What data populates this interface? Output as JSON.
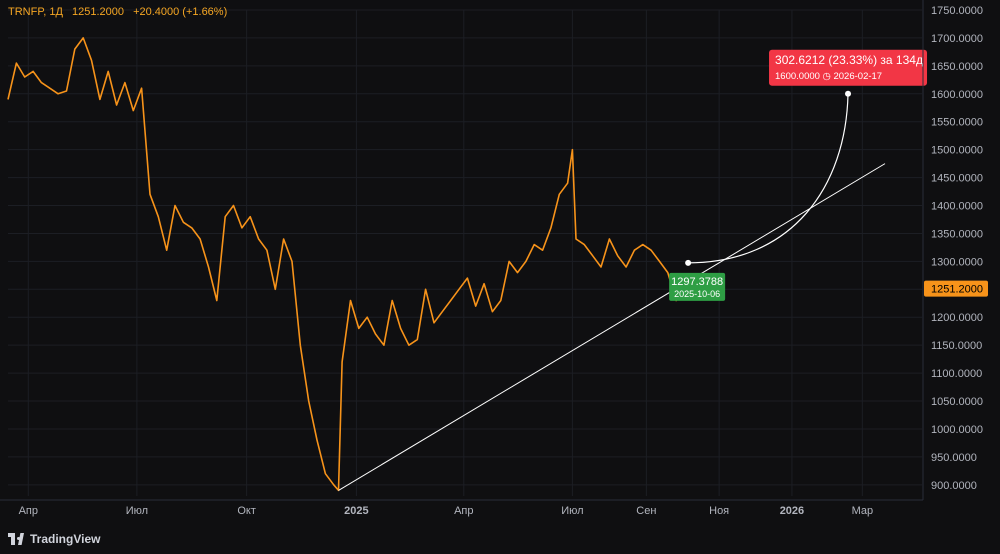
{
  "legend": {
    "ticker": "TRNFP, 1Д",
    "price": "1251.2000",
    "change": "+20.4000 (+1.66%)"
  },
  "branding": {
    "name": "TradingView",
    "icon": "tradingview-logo-icon"
  },
  "colors": {
    "price_line": "#f7931a",
    "background": "#0f0f11",
    "up_box": "#2e9e44",
    "down_box": "#f23645",
    "trend_line": "#ffffff",
    "axis_text": "#b2b5be"
  },
  "chart_data": {
    "type": "line",
    "title": "",
    "xlabel": "",
    "ylabel": "",
    "ylim": [
      880,
      1750
    ],
    "y_ticks": [
      "1750.0000",
      "1700.0000",
      "1650.0000",
      "1600.0000",
      "1550.0000",
      "1500.0000",
      "1450.0000",
      "1400.0000",
      "1350.0000",
      "1300.0000",
      "1250.0000",
      "1200.0000",
      "1150.0000",
      "1100.0000",
      "1050.0000",
      "1000.0000",
      "950.0000",
      "900.0000"
    ],
    "x_range": [
      "2024-03-15",
      "2026-04-20"
    ],
    "x_ticks": [
      {
        "label": "Апр",
        "date": "2024-04-01"
      },
      {
        "label": "Июл",
        "date": "2024-07-01"
      },
      {
        "label": "Окт",
        "date": "2024-10-01"
      },
      {
        "label": "2025",
        "date": "2025-01-01"
      },
      {
        "label": "Апр",
        "date": "2025-04-01"
      },
      {
        "label": "Июл",
        "date": "2025-07-01"
      },
      {
        "label": "Сен",
        "date": "2025-09-01"
      },
      {
        "label": "Ноя",
        "date": "2025-11-01"
      },
      {
        "label": "2026",
        "date": "2026-01-01"
      },
      {
        "label": "Мар",
        "date": "2026-03-01"
      }
    ],
    "series": [
      {
        "x": [
          "2024-03-15",
          "2024-03-22",
          "2024-03-29",
          "2024-04-05",
          "2024-04-12",
          "2024-04-19",
          "2024-04-26",
          "2024-05-03",
          "2024-05-10",
          "2024-05-17",
          "2024-05-24",
          "2024-05-31",
          "2024-06-07",
          "2024-06-14",
          "2024-06-21",
          "2024-06-28",
          "2024-07-05",
          "2024-07-12",
          "2024-07-19",
          "2024-07-26",
          "2024-08-02",
          "2024-08-09",
          "2024-08-16",
          "2024-08-23",
          "2024-08-30",
          "2024-09-06",
          "2024-09-13",
          "2024-09-20",
          "2024-09-27",
          "2024-10-04",
          "2024-10-11",
          "2024-10-18",
          "2024-10-25",
          "2024-11-01",
          "2024-11-08",
          "2024-11-15",
          "2024-11-22",
          "2024-11-29",
          "2024-12-06",
          "2024-12-13",
          "2024-12-17",
          "2024-12-20",
          "2024-12-27",
          "2025-01-03",
          "2025-01-10",
          "2025-01-17",
          "2025-01-24",
          "2025-01-31",
          "2025-02-07",
          "2025-02-14",
          "2025-02-21",
          "2025-02-28",
          "2025-03-07",
          "2025-03-14",
          "2025-03-21",
          "2025-03-28",
          "2025-04-04",
          "2025-04-11",
          "2025-04-18",
          "2025-04-25",
          "2025-05-02",
          "2025-05-09",
          "2025-05-16",
          "2025-05-23",
          "2025-05-30",
          "2025-06-06",
          "2025-06-13",
          "2025-06-20",
          "2025-06-27",
          "2025-07-01",
          "2025-07-04",
          "2025-07-11",
          "2025-07-18",
          "2025-07-25",
          "2025-08-01",
          "2025-08-08",
          "2025-08-15",
          "2025-08-22",
          "2025-08-29",
          "2025-09-05",
          "2025-09-12",
          "2025-09-19",
          "2025-09-26",
          "2025-10-03",
          "2025-10-06"
        ],
        "values": [
          1590,
          1655,
          1630,
          1640,
          1620,
          1610,
          1600,
          1605,
          1680,
          1700,
          1660,
          1590,
          1640,
          1580,
          1620,
          1570,
          1610,
          1420,
          1380,
          1320,
          1400,
          1370,
          1360,
          1340,
          1290,
          1230,
          1380,
          1400,
          1360,
          1380,
          1340,
          1320,
          1250,
          1340,
          1300,
          1150,
          1050,
          980,
          920,
          900,
          890,
          1120,
          1230,
          1180,
          1200,
          1170,
          1150,
          1230,
          1180,
          1150,
          1160,
          1250,
          1190,
          1210,
          1230,
          1250,
          1270,
          1220,
          1260,
          1210,
          1230,
          1300,
          1280,
          1300,
          1330,
          1320,
          1360,
          1420,
          1440,
          1500,
          1340,
          1330,
          1310,
          1290,
          1340,
          1310,
          1290,
          1320,
          1330,
          1320,
          1300,
          1280,
          1230,
          1250,
          1251.2
        ]
      }
    ],
    "last_price_label": "1251.2000",
    "trend_line": {
      "from": {
        "date": "2024-12-17",
        "value": 890
      },
      "to": {
        "date": "2026-03-20",
        "value": 1475
      }
    },
    "projection": {
      "start": {
        "date": "2025-10-06",
        "value": 1297.3788
      },
      "end": {
        "date": "2026-02-17",
        "value": 1600.0
      },
      "start_label": "1297.3788",
      "start_date_label": "2025-10-06",
      "end_label": "302.6212 (23.33%) за 134д",
      "end_sub_label": "1600.0000 ◷ 2026-02-17"
    }
  }
}
